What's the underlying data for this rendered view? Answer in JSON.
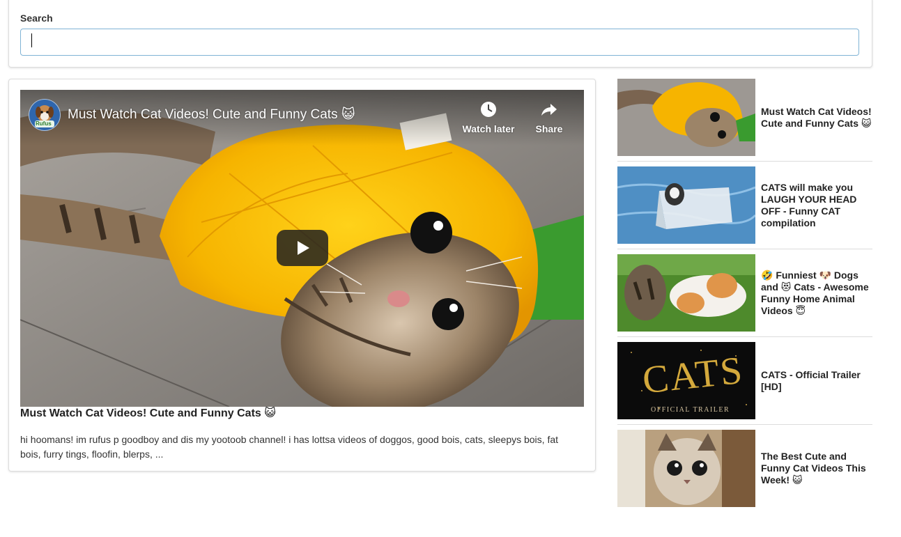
{
  "search": {
    "label": "Search",
    "value": "",
    "placeholder": ""
  },
  "player": {
    "title": "Must Watch Cat Videos! Cute and Funny Cats 😺",
    "channel_avatar_text": "Rufus",
    "watch_later_label": "Watch later",
    "share_label": "Share"
  },
  "video": {
    "title": "Must Watch Cat Videos! Cute and Funny Cats 😺",
    "description": "hi hoomans! im rufus p goodboy and dis my yootoob channel! i has lottsa videos of doggos, good bois, cats, sleepys bois, fat bois, furry tings, floofin, blerps, ..."
  },
  "sidebar": {
    "items": [
      {
        "title": "Must Watch Cat Videos! Cute and Funny Cats 😺"
      },
      {
        "title": "CATS will make you LAUGH YOUR HEAD OFF - Funny CAT compilation"
      },
      {
        "title": "🤣 Funniest 🐶 Dogs and 😻 Cats - Awesome Funny Home Animal Videos 😇"
      },
      {
        "title": "CATS - Official Trailer [HD]",
        "thumb_text": "CATS",
        "thumb_subtext": "OFFICIAL TRAILER"
      },
      {
        "title": "The Best Cute and Funny Cat Videos This Week! 😺"
      }
    ]
  },
  "colors": {
    "input_border": "#7fb3d5",
    "hood_yellow": "#f6b400",
    "card_border": "#dcdcdc"
  }
}
